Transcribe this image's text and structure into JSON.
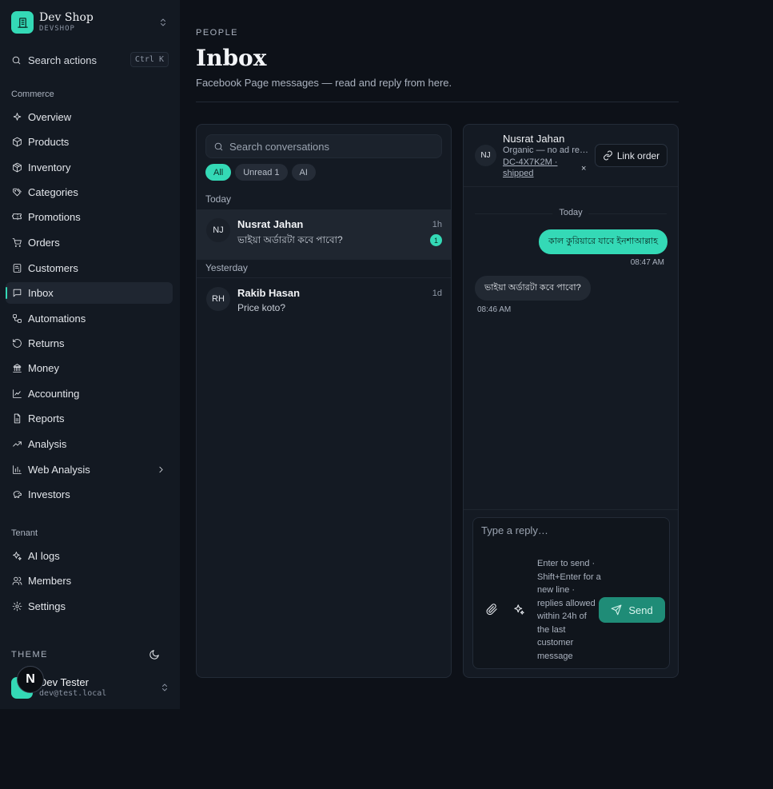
{
  "brand": {
    "name": "Dev Shop",
    "slug": "DEVSHOP"
  },
  "search_actions": {
    "label": "Search actions",
    "shortcut": "Ctrl K"
  },
  "sidebar": {
    "commerce_label": "Commerce",
    "commerce_items": [
      {
        "label": "Overview",
        "icon": "sparkle-icon"
      },
      {
        "label": "Products",
        "icon": "box-icon"
      },
      {
        "label": "Inventory",
        "icon": "package-icon"
      },
      {
        "label": "Categories",
        "icon": "tags-icon"
      },
      {
        "label": "Promotions",
        "icon": "ticket-icon"
      },
      {
        "label": "Orders",
        "icon": "cart-icon"
      },
      {
        "label": "Customers",
        "icon": "contact-card-icon"
      },
      {
        "label": "Inbox",
        "icon": "message-square-icon",
        "active": true
      },
      {
        "label": "Automations",
        "icon": "workflow-icon"
      },
      {
        "label": "Returns",
        "icon": "rotate-ccw-icon"
      },
      {
        "label": "Money",
        "icon": "bank-icon"
      },
      {
        "label": "Accounting",
        "icon": "line-chart-icon"
      },
      {
        "label": "Reports",
        "icon": "file-text-icon"
      },
      {
        "label": "Analysis",
        "icon": "trending-up-icon"
      },
      {
        "label": "Web Analysis",
        "icon": "bar-chart-icon"
      },
      {
        "label": "Investors",
        "icon": "piggy-bank-icon"
      }
    ],
    "tenant_label": "Tenant",
    "tenant_items": [
      {
        "label": "AI logs",
        "icon": "sparkles-icon"
      },
      {
        "label": "Members",
        "icon": "users-icon"
      },
      {
        "label": "Settings",
        "icon": "gear-icon"
      }
    ],
    "theme_label": "THEME",
    "user": {
      "name": "Dev Tester",
      "email": "dev@test.local"
    },
    "overlay_badge": "N"
  },
  "header": {
    "eyebrow": "PEOPLE",
    "title": "Inbox",
    "subtitle": "Facebook Page messages — read and reply from here."
  },
  "conversations": {
    "search_placeholder": "Search conversations",
    "filters": [
      "All",
      "Unread 1",
      "AI"
    ],
    "active_filter": "All",
    "groups": [
      {
        "label": "Today",
        "items": [
          {
            "initials": "NJ",
            "name": "Nusrat Jahan",
            "preview": "ভাইয়া অর্ডারটা কবে পাবো?",
            "time": "1h",
            "unread": "1",
            "selected": true
          }
        ]
      },
      {
        "label": "Yesterday",
        "items": [
          {
            "initials": "RH",
            "name": "Rakib Hasan",
            "preview": "Price koto?",
            "time": "1d"
          }
        ]
      }
    ]
  },
  "chat": {
    "initials": "NJ",
    "name": "Nusrat Jahan",
    "source": "Organic — no ad referral",
    "order_ref": "DC-4X7K2M · shipped",
    "unlink": "×",
    "link_order_label": "Link order",
    "day_label": "Today",
    "messages": [
      {
        "direction": "out",
        "text": "কাল কুরিয়ারে যাবে ইনশাআল্লাহ",
        "time": "08:47 AM"
      },
      {
        "direction": "in",
        "text": "ভাইয়া অর্ডারটা কবে পাবো?",
        "time": "08:46 AM"
      }
    ],
    "composer": {
      "placeholder": "Type a reply…",
      "hint": "Enter to send · Shift+Enter for a new line · replies allowed within 24h of the last customer message",
      "send_label": "Send"
    }
  },
  "colors": {
    "accent": "#34d9b6",
    "background": "#0d1118",
    "sidebar": "#131922",
    "panel": "#141a23"
  }
}
